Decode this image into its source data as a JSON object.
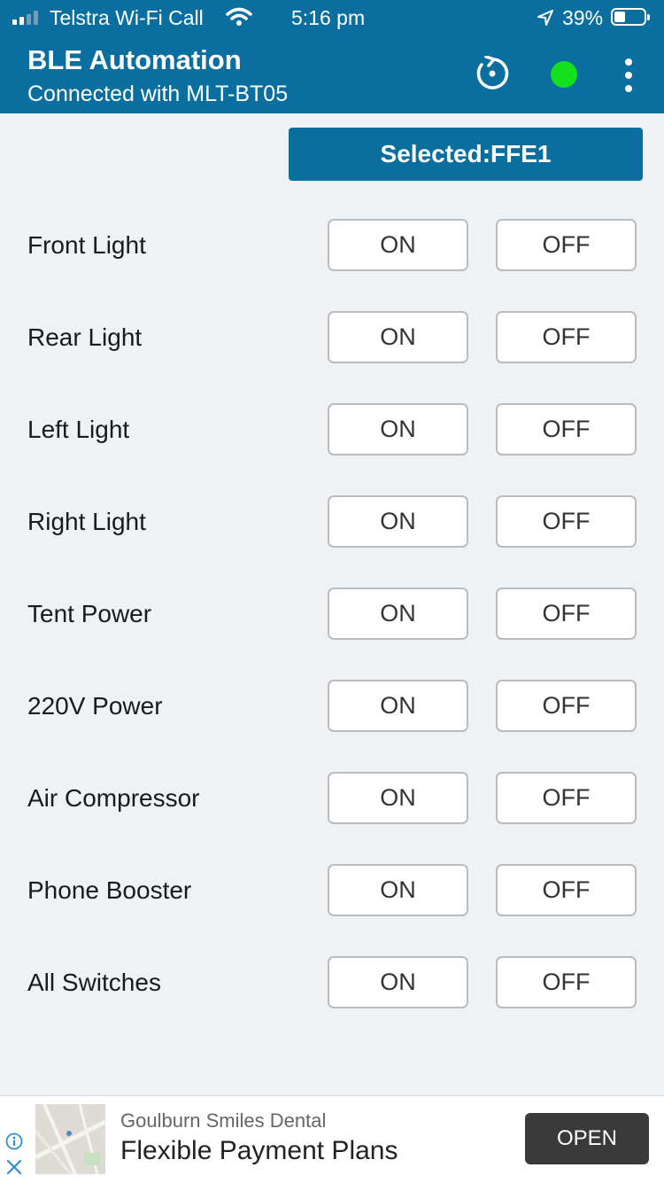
{
  "status_bar": {
    "carrier": "Telstra Wi-Fi Call",
    "time": "5:16 pm",
    "battery": "39%",
    "battery_level": 0.39,
    "icons": [
      "signal-icon",
      "wifi-icon",
      "location-arrow-icon",
      "battery-icon"
    ]
  },
  "header": {
    "title": "BLE Automation",
    "subtitle": "Connected with MLT-BT05",
    "icons": [
      "refresh-icon",
      "connection-status-icon",
      "more-vertical-icon"
    ],
    "status_color": "#14e01e",
    "accent_color": "#0a6f9e"
  },
  "selected_button": "Selected:FFE1",
  "switches": [
    {
      "label": "Front Light",
      "on": "ON",
      "off": "OFF"
    },
    {
      "label": "Rear Light",
      "on": "ON",
      "off": "OFF"
    },
    {
      "label": "Left Light",
      "on": "ON",
      "off": "OFF"
    },
    {
      "label": "Right Light",
      "on": "ON",
      "off": "OFF"
    },
    {
      "label": "Tent Power",
      "on": "ON",
      "off": "OFF"
    },
    {
      "label": "220V Power",
      "on": "ON",
      "off": "OFF"
    },
    {
      "label": "Air Compressor",
      "on": "ON",
      "off": "OFF"
    },
    {
      "label": "Phone Booster",
      "on": "ON",
      "off": "OFF"
    },
    {
      "label": "All Switches",
      "on": "ON",
      "off": "OFF"
    }
  ],
  "ad": {
    "advertiser": "Goulburn Smiles Dental",
    "headline": "Flexible Payment Plans",
    "cta": "OPEN",
    "icons": [
      "ad-info-icon",
      "ad-close-icon",
      "map-thumbnail"
    ]
  }
}
